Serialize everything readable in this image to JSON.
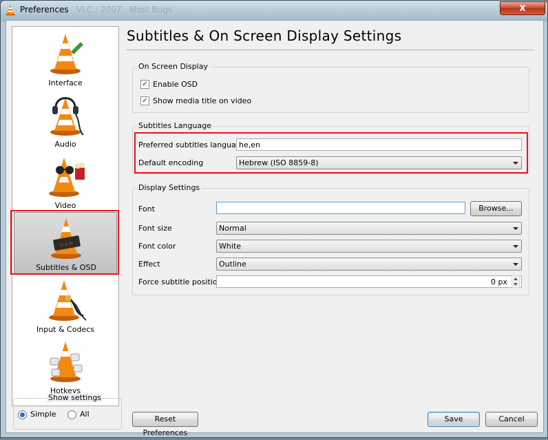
{
  "window": {
    "title": "Preferences",
    "ghost_title": "VLC / 2007 · Most Bugs",
    "close_glyph": "X"
  },
  "sidebar": {
    "items": [
      {
        "label": "Interface",
        "icon": "interface-cone-icon"
      },
      {
        "label": "Audio",
        "icon": "headphones-cone-icon"
      },
      {
        "label": "Video",
        "icon": "glasses-cone-icon"
      },
      {
        "label": "Subtitles & OSD",
        "icon": "subtitles-cone-icon",
        "selected": true
      },
      {
        "label": "Input & Codecs",
        "icon": "cable-cone-icon"
      },
      {
        "label": "Hotkeys",
        "icon": "keyboard-cone-icon"
      }
    ]
  },
  "show_settings": {
    "title": "Show settings",
    "simple_label": "Simple",
    "all_label": "All",
    "selected": "Simple"
  },
  "page": {
    "title": "Subtitles & On Screen Display Settings"
  },
  "osd": {
    "title": "On Screen Display",
    "enable_osd_label": "Enable OSD",
    "enable_osd_checked": true,
    "show_title_label": "Show media title on video",
    "show_title_checked": true,
    "check_glyph": "✓"
  },
  "subs_lang": {
    "title": "Subtitles Language",
    "preferred_label": "Preferred subtitles language",
    "preferred_value": "he,en",
    "encoding_label": "Default encoding",
    "encoding_value": "Hebrew (ISO 8859-8)"
  },
  "display": {
    "title": "Display Settings",
    "font_label": "Font",
    "font_value": "",
    "browse_label": "Browse...",
    "font_size_label": "Font size",
    "font_size_value": "Normal",
    "font_color_label": "Font color",
    "font_color_value": "White",
    "effect_label": "Effect",
    "effect_value": "Outline",
    "position_label": "Force subtitle position",
    "position_value": "0 px"
  },
  "footer": {
    "reset_label": "Reset Preferences",
    "save_label": "Save",
    "cancel_label": "Cancel"
  },
  "colors": {
    "highlight_red": "#e8141b",
    "cone_orange": "#f28a12",
    "titlebar_blue": "#9fb8c6"
  }
}
